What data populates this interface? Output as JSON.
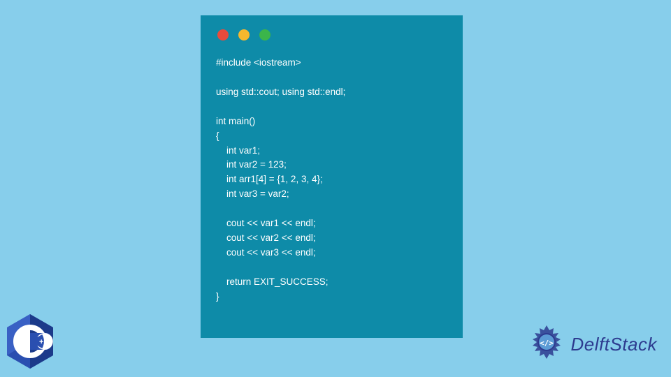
{
  "code": {
    "lines": [
      "#include <iostream>",
      "",
      "using std::cout; using std::endl;",
      "",
      "int main()",
      "{",
      "    int var1;",
      "    int var2 = 123;",
      "    int arr1[4] = {1, 2, 3, 4};",
      "    int var3 = var2;",
      "",
      "    cout << var1 << endl;",
      "    cout << var2 << endl;",
      "    cout << var3 << endl;",
      "",
      "    return EXIT_SUCCESS;",
      "}"
    ]
  },
  "traffic_lights": {
    "red": "#e94b3c",
    "yellow": "#f5b82e",
    "green": "#3bb54a"
  },
  "cpp_badge": {
    "label": "C++",
    "color": "#1b3a8a"
  },
  "brand": {
    "name": "DelftStack",
    "color": "#2d3b8f"
  }
}
